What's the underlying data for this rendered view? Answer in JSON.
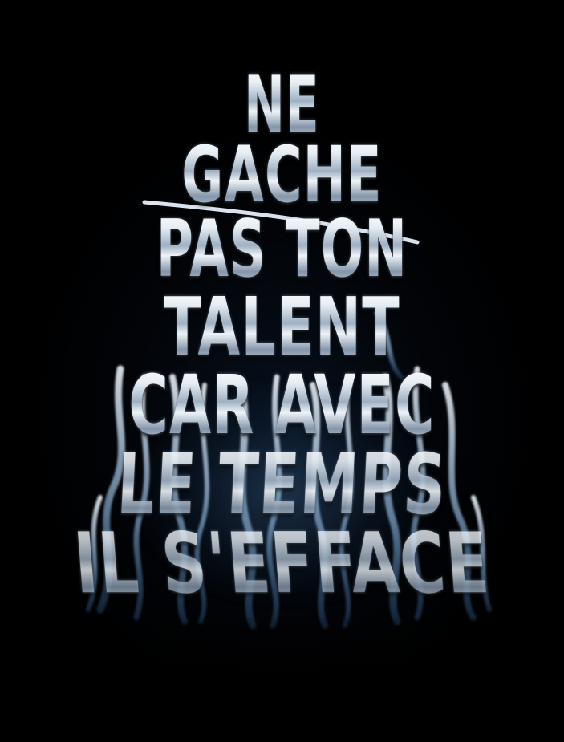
{
  "poster": {
    "lines": [
      "NE",
      "GACHE",
      "PAS TON",
      "TALENT",
      "CAR AVEC",
      "LE TEMPS",
      "IL S'EFFACE"
    ]
  },
  "colors": {
    "background": "#000000",
    "letter_highlight": "#ffffff",
    "letter_mid": "#9fb0c2",
    "smoke_blue": "#4a7eb0"
  }
}
